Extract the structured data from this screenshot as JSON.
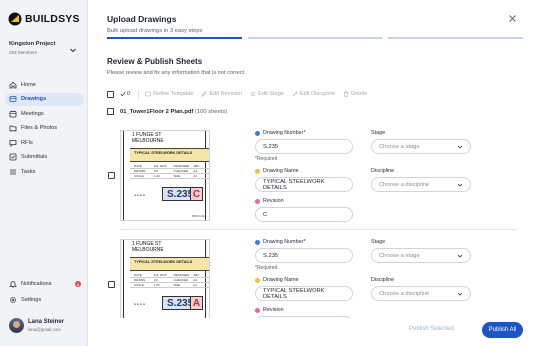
{
  "app": {
    "name": "BUILDSYS"
  },
  "project": {
    "name": "Kingston Project",
    "members": "254 Members"
  },
  "nav": [
    {
      "label": "Home",
      "icon": "home-icon"
    },
    {
      "label": "Drawings",
      "icon": "drawings-icon",
      "active": true
    },
    {
      "label": "Meetings",
      "icon": "meetings-icon"
    },
    {
      "label": "Files & Photos",
      "icon": "files-icon"
    },
    {
      "label": "RFIs",
      "icon": "rfi-icon"
    },
    {
      "label": "Submittals",
      "icon": "submittals-icon"
    },
    {
      "label": "Tasks",
      "icon": "tasks-icon"
    }
  ],
  "nav_bottom": {
    "notifications": {
      "label": "Notifications",
      "badge": "2"
    },
    "settings": {
      "label": "Settings"
    }
  },
  "user": {
    "name": "Lana Steiner",
    "email": "lana@gmail.com"
  },
  "modal": {
    "title": "Upload Drawings",
    "subtitle": "Bulk upload drawings in 3 easy steps",
    "steps_completed": 1,
    "steps_total": 3
  },
  "review": {
    "title": "Review & Publish Sheets",
    "subtitle": "Please review and fix any information that is not correct."
  },
  "toolbar": {
    "selected_count": "0",
    "refine_template": "Refine Template",
    "edit_revision": "Edit Revision",
    "edit_stage": "Edit Stage",
    "edit_discipline": "Edit Discipline",
    "delete": "Delete"
  },
  "file": {
    "name": "01_Tower1Floor 2 Plan.pdf",
    "count": "(100 sheets)"
  },
  "labels": {
    "drawing_number": "Drawing Number*",
    "drawing_name": "Drawing Name",
    "revision": "Revision",
    "stage": "Stage",
    "discipline": "Discipline",
    "required": "*Required",
    "stage_placeholder": "Choose a stage",
    "discipline_placeholder": "Choose a discipline"
  },
  "sheets": [
    {
      "drawing_number": "S.235",
      "drawing_name": "TYPICAL STEELWORK DETAILS",
      "revision": "C",
      "thumb": {
        "address1": "1 FUNGE ST",
        "address2": "MELBOURNE",
        "title": "TYPICAL STEELWORK DETAILS",
        "number": "S.235",
        "rev": "C",
        "dashes": "----",
        "rows": [
          [
            "DATE",
            "JUL 2016",
            "DESIGNED",
            "ABC"
          ],
          [
            "DRAWN",
            "CC",
            "CHECKED",
            "AA"
          ],
          [
            "SCALE",
            "1:20",
            "SIZE",
            "A1"
          ]
        ],
        "brand": "BROGUE"
      }
    },
    {
      "drawing_number": "S.235",
      "drawing_name": "TYPICAL STEELWORK DETAILS",
      "revision": "",
      "thumb": {
        "address1": "1 FUNGE ST",
        "address2": "MELBOURNE",
        "title": "TYPICAL STEELWORK DETAILS",
        "number": "S.235",
        "rev": "A",
        "dashes": "----",
        "rows": [
          [
            "DATE",
            "JUL 2016",
            "DESIGNED",
            "ABC"
          ],
          [
            "DRAWN",
            "CC",
            "CHECKED",
            "AA"
          ],
          [
            "SCALE",
            "1:20",
            "SIZE",
            "A1"
          ]
        ],
        "brand": ""
      }
    }
  ],
  "footer": {
    "publish_selected": "Publish Selected",
    "publish_all": "Publish All"
  },
  "colors": {
    "primary": "#1d55c9",
    "sidebar_bg": "#f2f3f6",
    "active_bg": "#dfe6f4",
    "logo": "#f3c316"
  }
}
